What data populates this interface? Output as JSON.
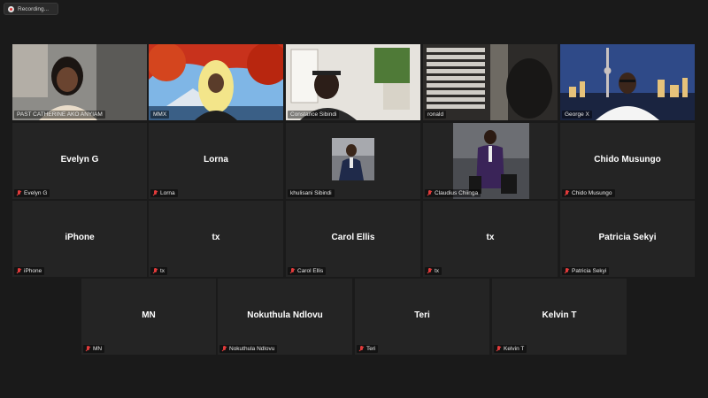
{
  "recording": {
    "label": "Recording..."
  },
  "participants": [
    {
      "name": "PAST CATHERINE AKO ANYIAM",
      "tile_text": "",
      "muted": false
    },
    {
      "name": "MMX",
      "tile_text": "",
      "muted": false
    },
    {
      "name": "Constance Sibindi",
      "tile_text": "",
      "muted": false
    },
    {
      "name": "ronald",
      "tile_text": "",
      "muted": false
    },
    {
      "name": "George X",
      "tile_text": "",
      "muted": false
    },
    {
      "name": "Evelyn G",
      "tile_text": "Evelyn G",
      "muted": true
    },
    {
      "name": "Lorna",
      "tile_text": "Lorna",
      "muted": true
    },
    {
      "name": "khulisani Sibindi",
      "tile_text": "",
      "muted": false
    },
    {
      "name": "Claudius Chiinga",
      "tile_text": "",
      "muted": true
    },
    {
      "name": "Chido Musungo",
      "tile_text": "Chido Musungo",
      "muted": true
    },
    {
      "name": "iPhone",
      "tile_text": "iPhone",
      "muted": true
    },
    {
      "name": "tx",
      "tile_text": "tx",
      "muted": true
    },
    {
      "name": "Carol Ellis",
      "tile_text": "Carol Ellis",
      "muted": true
    },
    {
      "name": "tx",
      "tile_text": "tx",
      "muted": true
    },
    {
      "name": "Patricia Sekyi",
      "tile_text": "Patricia Sekyi",
      "muted": true
    },
    {
      "name": "MN",
      "tile_text": "MN",
      "muted": true
    },
    {
      "name": "Nokuthula Ndlovu",
      "tile_text": "Nokuthula Ndlovu",
      "muted": true
    },
    {
      "name": "Teri",
      "tile_text": "Teri",
      "muted": true
    },
    {
      "name": "Kelvin T",
      "tile_text": "Kelvin T",
      "muted": true
    }
  ],
  "colors": {
    "background": "#1a1a1a",
    "tile": "#242424",
    "active_speaker": "#d7d83c",
    "muted_icon": "#e23b3b"
  },
  "active_speaker_index": 1
}
